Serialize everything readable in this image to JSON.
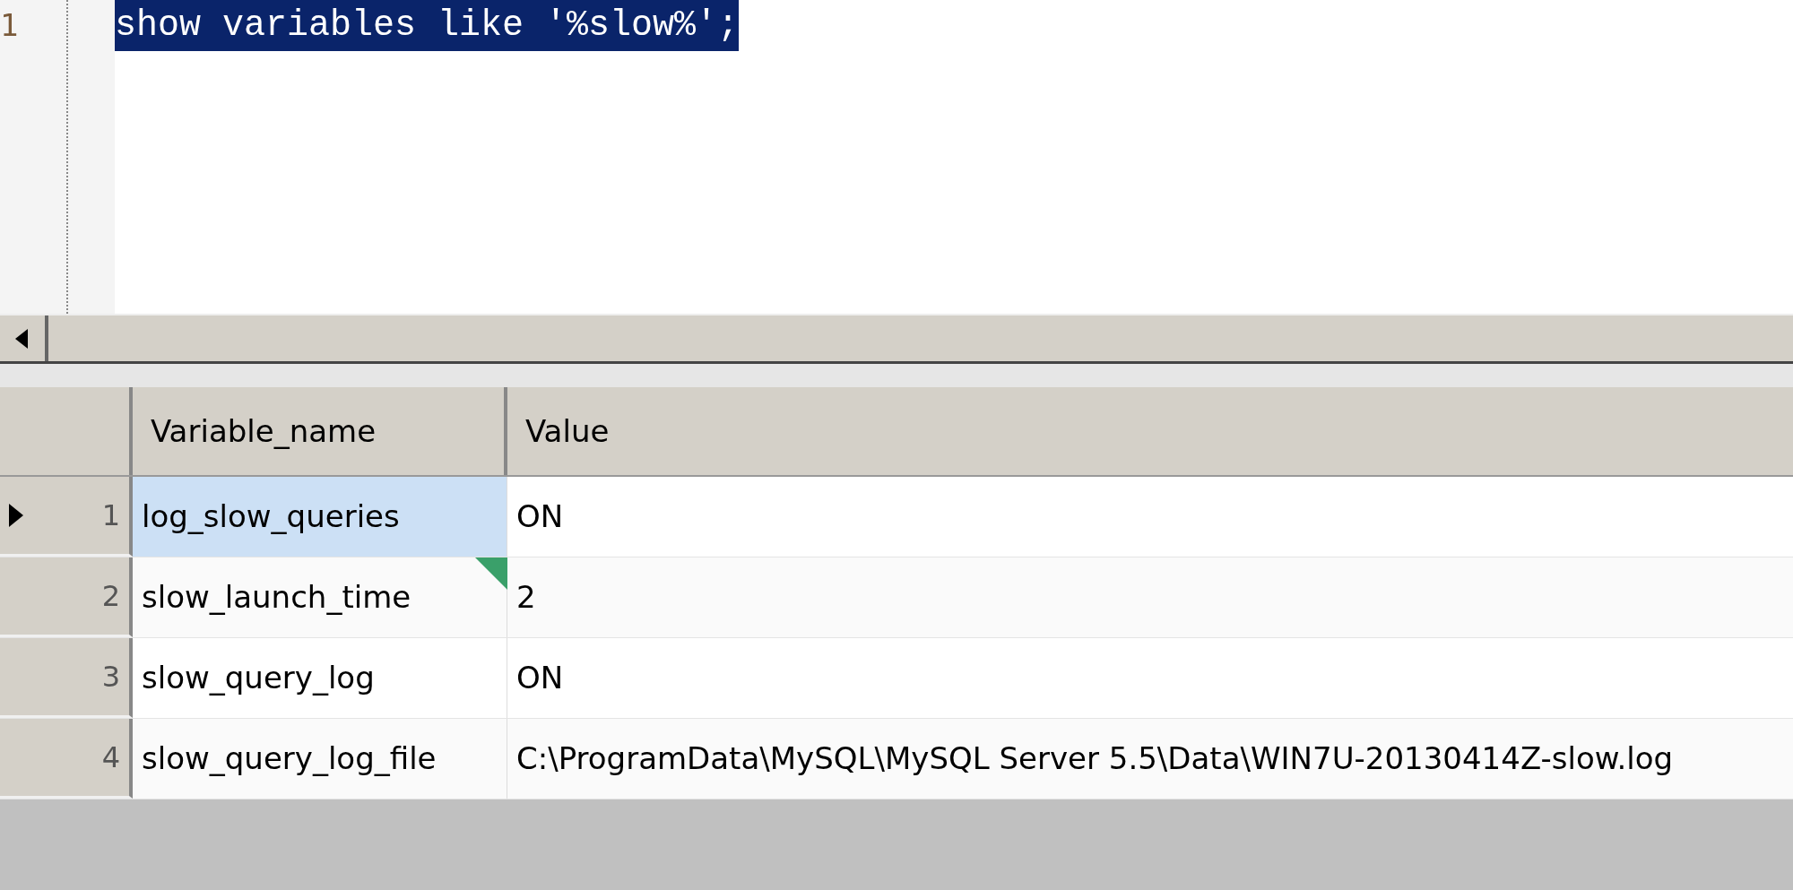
{
  "editor": {
    "lines": [
      {
        "number": "1",
        "code": "show variables like '%slow%';",
        "selected": true
      }
    ]
  },
  "table": {
    "columns": [
      "Variable_name",
      "Value"
    ],
    "rows": [
      {
        "number": "1",
        "cells": [
          "log_slow_queries",
          "ON"
        ],
        "selected": true,
        "flagged": false
      },
      {
        "number": "2",
        "cells": [
          "slow_launch_time",
          "2"
        ],
        "selected": false,
        "flagged": true
      },
      {
        "number": "3",
        "cells": [
          "slow_query_log",
          "ON"
        ],
        "selected": false,
        "flagged": false
      },
      {
        "number": "4",
        "cells": [
          "slow_query_log_file",
          "C:\\ProgramData\\MySQL\\MySQL Server 5.5\\Data\\WIN7U-20130414Z-slow.log"
        ],
        "selected": false,
        "flagged": false
      }
    ]
  }
}
